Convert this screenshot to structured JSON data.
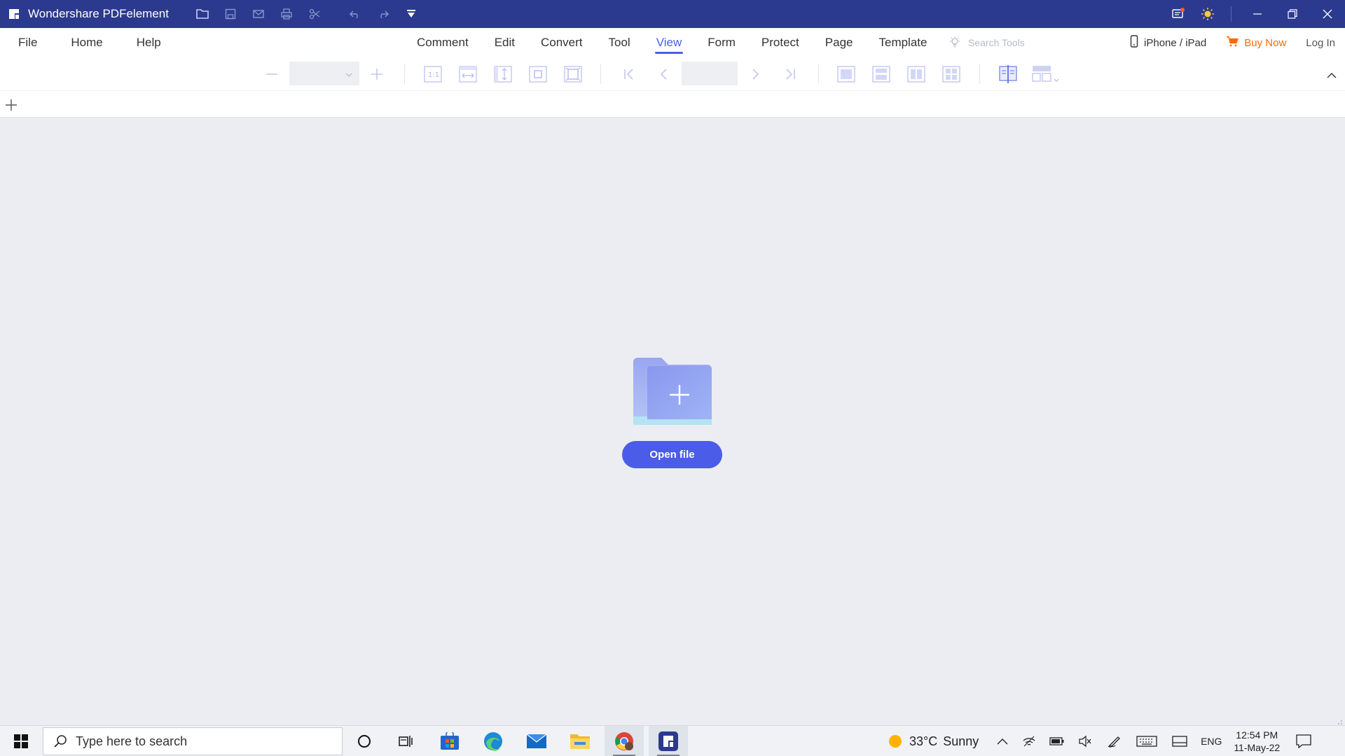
{
  "titlebar": {
    "app_title": "Wondershare PDFelement",
    "quick_access": [
      "open-folder-icon",
      "save-icon",
      "mail-icon",
      "print-icon",
      "scissors-icon",
      "undo-icon",
      "redo-icon",
      "customize-icon"
    ],
    "right_icons": [
      "notification-icon",
      "theme-sun-icon"
    ],
    "window_controls": [
      "minimize-icon",
      "restore-icon",
      "close-icon"
    ]
  },
  "menubar": {
    "left": [
      "File",
      "Home",
      "Help"
    ],
    "tabs": [
      "Comment",
      "Edit",
      "Convert",
      "Tool",
      "View",
      "Form",
      "Protect",
      "Page",
      "Template"
    ],
    "active_tab": "View",
    "search_tools_placeholder": "Search Tools",
    "iphone_ipad": "iPhone / iPad",
    "buy_now": "Buy Now",
    "log_in": "Log In"
  },
  "toolbar": {
    "zoom_value": "",
    "page_value": ""
  },
  "main": {
    "open_file_label": "Open file"
  },
  "taskbar": {
    "search_placeholder": "Type here to search",
    "weather_temp": "33°C",
    "weather_text": "Sunny",
    "language": "ENG",
    "time": "12:54 PM",
    "date": "11-May-22"
  },
  "colors": {
    "titlebar": "#2b3a8f",
    "accent": "#4a5fe6",
    "buy_now": "#ff6a00",
    "background": "#ecedf2"
  }
}
